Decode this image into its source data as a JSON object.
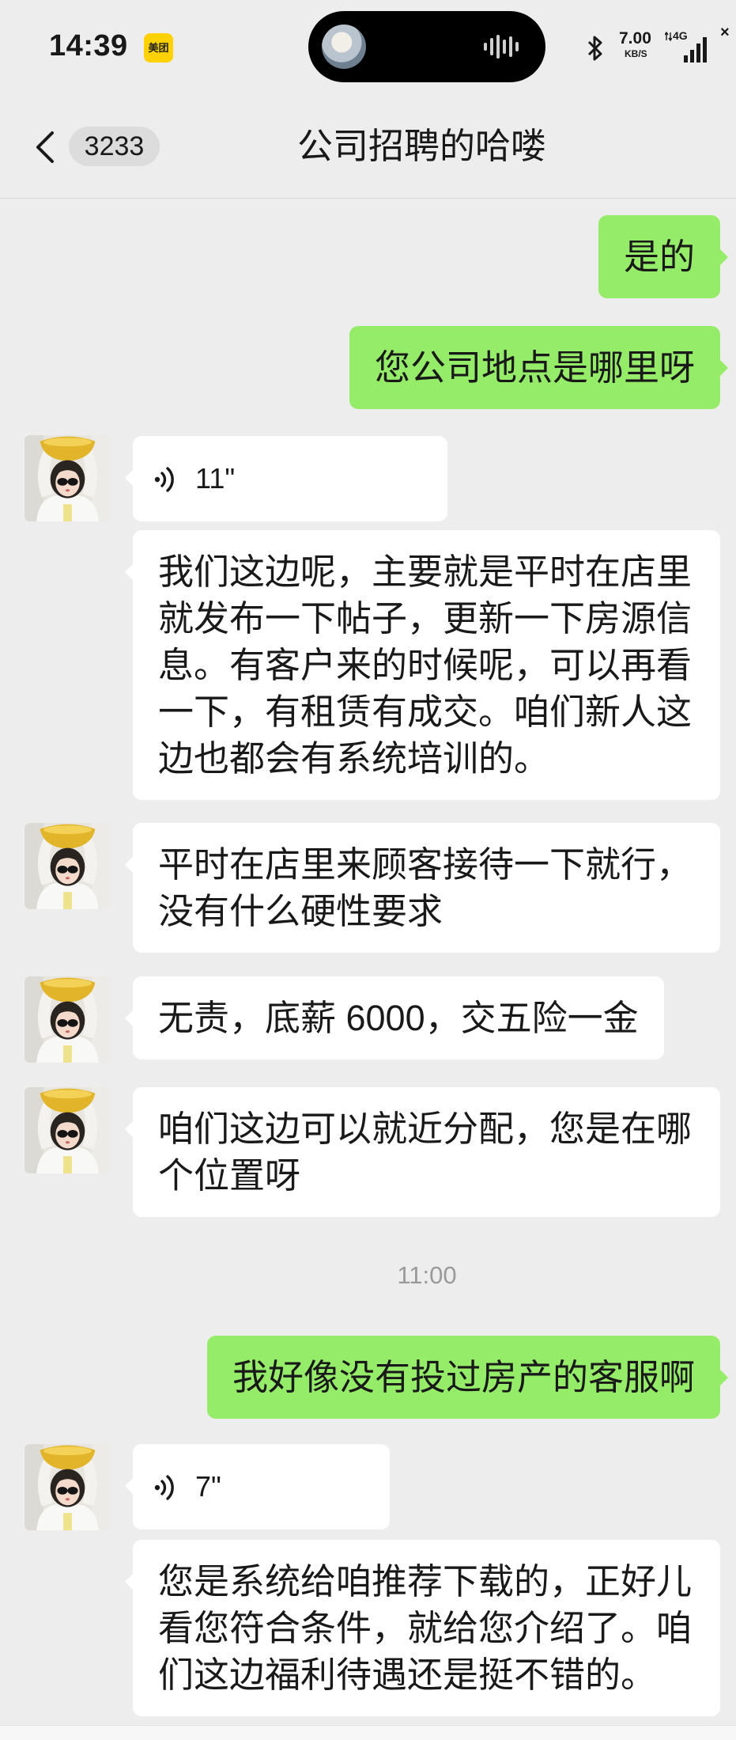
{
  "status_bar": {
    "time": "14:39",
    "app_badge": "美团",
    "net_speed_value": "7.00",
    "net_speed_unit": "KB/S",
    "network": "4G",
    "sim2": "×"
  },
  "header": {
    "back_icon": "chevron-left-icon",
    "unread_count": "3233",
    "title": "公司招聘的哈喽"
  },
  "messages": [
    {
      "side": "right",
      "type": "text",
      "text": "是的"
    },
    {
      "side": "right",
      "type": "text",
      "text": "您公司地点是哪里呀"
    },
    {
      "side": "left",
      "type": "voice",
      "duration": "11\""
    },
    {
      "side": "left",
      "type": "text",
      "text": "我们这边呢，主要就是平时在店里就发布一下帖子，更新一下房源信息。有客户来的时候呢，可以再看一下，有租赁有成交。咱们新人这边也都会有系统培训的。"
    },
    {
      "side": "left",
      "type": "text",
      "text": "平时在店里来顾客接待一下就行，没有什么硬性要求"
    },
    {
      "side": "left",
      "type": "text",
      "text": "无责，底薪 6000，交五险一金"
    },
    {
      "side": "left",
      "type": "text",
      "text": "咱们这边可以就近分配，您是在哪个位置呀"
    },
    {
      "side": "right",
      "type": "text",
      "text": "我好像没有投过房产的客服啊"
    },
    {
      "side": "left",
      "type": "voice",
      "duration": "7\""
    },
    {
      "side": "left",
      "type": "text",
      "text": "您是系统给咱推荐下载的，正好儿看您符合条件，就给您介绍了。咱们这边福利待遇还是挺不错的。"
    }
  ],
  "time_divider": "11:00",
  "icons": {
    "voice": "voice-wave-icon",
    "bluetooth": "bluetooth-icon",
    "signal": "signal-bars-icon",
    "island_audio": "audio-waveform-icon"
  },
  "colors": {
    "background": "#ededed",
    "bubble_self": "#95ec69",
    "bubble_other": "#ffffff",
    "text": "#191919"
  }
}
